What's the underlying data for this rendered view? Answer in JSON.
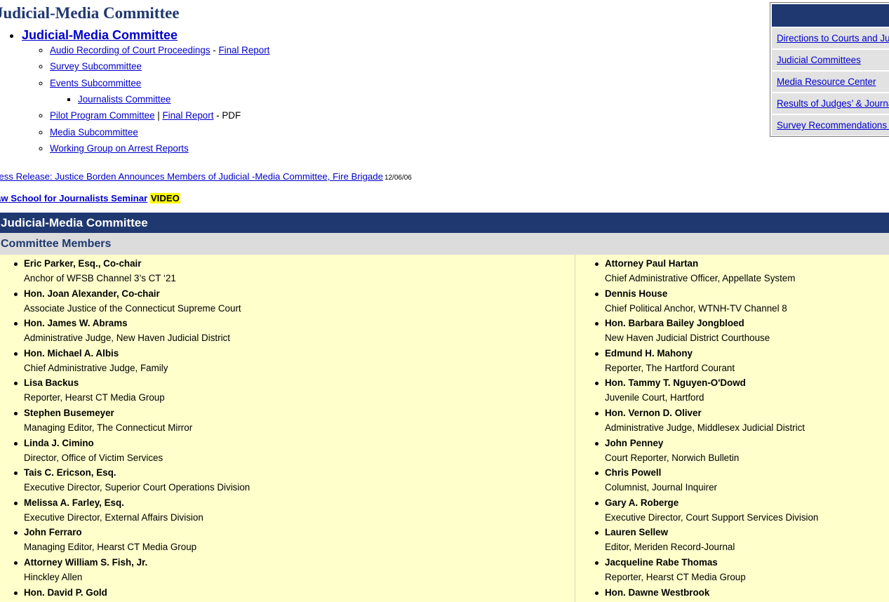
{
  "page": {
    "title": "Judicial-Media Committee"
  },
  "nav": {
    "root_label": "Judicial-Media Committee",
    "audio_recording": "Audio Recording of Court Proceedings",
    "audio_sep": " - ",
    "audio_final_report": "Final Report",
    "survey": "Survey Subcommittee",
    "events": "Events Subcommittee",
    "journalists": "Journalists Committee",
    "pilot_program": "Pilot Program Committee",
    "pilot_sep": " | ",
    "pilot_final_report": "Final Report",
    "pilot_suffix": " - PDF",
    "media_sub": "Media Subcommittee",
    "working_group": "Working Group on Arrest Reports"
  },
  "press_release": {
    "text": "ress Release: Justice Borden Announces Members of Judicial -Media Committee, Fire Brigade",
    "date": "12/06/06"
  },
  "law_school": {
    "text": "aw School for Journalists Seminar",
    "badge": "VIDEO"
  },
  "section": {
    "title": "Judicial-Media Committee",
    "subtitle": "Committee Members"
  },
  "members_left": [
    {
      "name": "Eric Parker, Esq., Co-chair",
      "role": "Anchor of WFSB Channel 3’s CT ‘21"
    },
    {
      "name": "Hon. Joan Alexander, Co-chair",
      "role": "Associate Justice of the Connecticut Supreme Court"
    },
    {
      "name": "Hon. James W. Abrams",
      "role": "Administrative Judge, New Haven Judicial District"
    },
    {
      "name": "Hon. Michael A. Albis",
      "role": "Chief Administrative Judge, Family"
    },
    {
      "name": "Lisa Backus",
      "role": "Reporter, Hearst CT Media Group"
    },
    {
      "name": "Stephen Busemeyer",
      "role": "Managing Editor, The Connecticut Mirror"
    },
    {
      "name": "Linda J. Cimino",
      "role": "Director, Office of Victim Services"
    },
    {
      "name": "Tais C. Ericson, Esq.",
      "role": "Executive Director, Superior Court Operations Division"
    },
    {
      "name": "Melissa A. Farley, Esq.",
      "role": "Executive Director, External Affairs Division"
    },
    {
      "name": "John Ferraro",
      "role": "Managing Editor, Hearst CT Media Group"
    },
    {
      "name": "Attorney William S. Fish, Jr.",
      "role": "Hinckley Allen"
    },
    {
      "name": "Hon. David P. Gold",
      "role": ""
    }
  ],
  "members_right": [
    {
      "name": "Attorney Paul Hartan",
      "role": "Chief Administrative Officer, Appellate System"
    },
    {
      "name": "Dennis House",
      "role": "Chief Political Anchor, WTNH-TV Channel 8"
    },
    {
      "name": "Hon. Barbara Bailey Jongbloed",
      "role": "New Haven Judicial District Courthouse"
    },
    {
      "name": "Edmund H. Mahony",
      "role": "Reporter, The Hartford Courant"
    },
    {
      "name": "Hon. Tammy T. Nguyen-O'Dowd",
      "role": "Juvenile Court, Hartford"
    },
    {
      "name": "Hon. Vernon D. Oliver",
      "role": "Administrative Judge, Middlesex Judicial District"
    },
    {
      "name": "John Penney",
      "role": "Court Reporter, Norwich Bulletin"
    },
    {
      "name": "Chris Powell",
      "role": "Columnist, Journal Inquirer"
    },
    {
      "name": "Gary A. Roberge",
      "role": "Executive Director, Court Support Services Division"
    },
    {
      "name": "Lauren Sellew",
      "role": "Editor, Meriden Record-Journal"
    },
    {
      "name": "Jacqueline Rabe Thomas",
      "role": "Reporter, Hearst CT Media Group"
    },
    {
      "name": "Hon. Dawne Westbrook",
      "role": ""
    }
  ],
  "quick_links": [
    "Directions to Courts and Judicial Facilities",
    "Judicial Committees",
    "Media Resource Center",
    "Results of Judges’ & Journalists’ Survey",
    "Survey Recommendations Report"
  ],
  "colors": {
    "navy": "#1f3870",
    "members_bg": "#ffffcc",
    "subbar_bg": "#dcdcdc",
    "link": "#0000cc",
    "highlight": "#ffff00"
  }
}
